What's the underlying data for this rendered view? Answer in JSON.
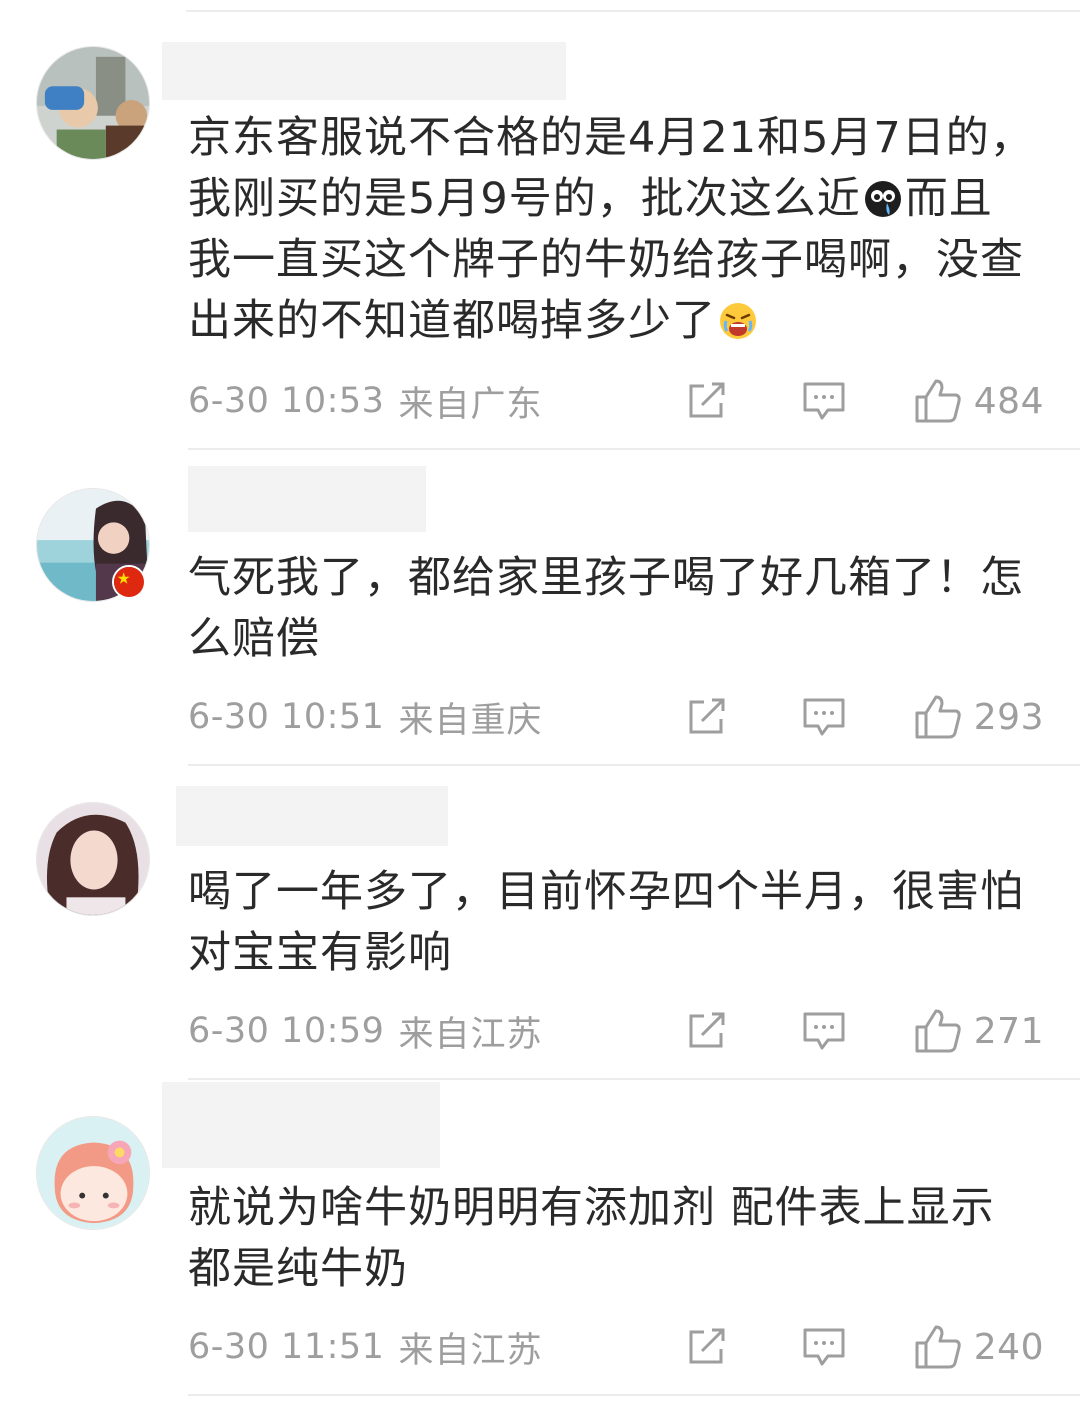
{
  "comments": [
    {
      "text_a": "京东客服说不合格的是4月21和5月7日的，\n我刚买的是5月9号的，批次这么近",
      "text_b": "而且\n我一直买这个牌子的牛奶给孩子喝啊，没查\n出来的不知道都喝掉多少了",
      "time": "6-30 10:53",
      "location": "来自广东",
      "likes": "484"
    },
    {
      "text_a": "气死我了，都给家里孩子喝了好几箱了！怎\n么赔偿",
      "time": "6-30 10:51",
      "location": "来自重庆",
      "likes": "293"
    },
    {
      "text_a": "喝了一年多了，目前怀孕四个半月，很害怕\n对宝宝有影响",
      "time": "6-30 10:59",
      "location": "来自江苏",
      "likes": "271"
    },
    {
      "text_a": "就说为啥牛奶明明有添加剂 配件表上显示\n都是纯牛奶",
      "time": "6-30 11:51",
      "location": "来自江苏",
      "likes": "240"
    }
  ],
  "icons": {
    "share": "share-icon",
    "comment": "comment-icon",
    "like": "thumbs-up-icon",
    "emoji_1": "crying-face-emoji",
    "emoji_2": "angry-crying-face-emoji"
  },
  "colors": {
    "text": "#2a2a2a",
    "meta": "#9e9e9e",
    "divider": "#ececec",
    "redaction": "#f3f3f3"
  }
}
